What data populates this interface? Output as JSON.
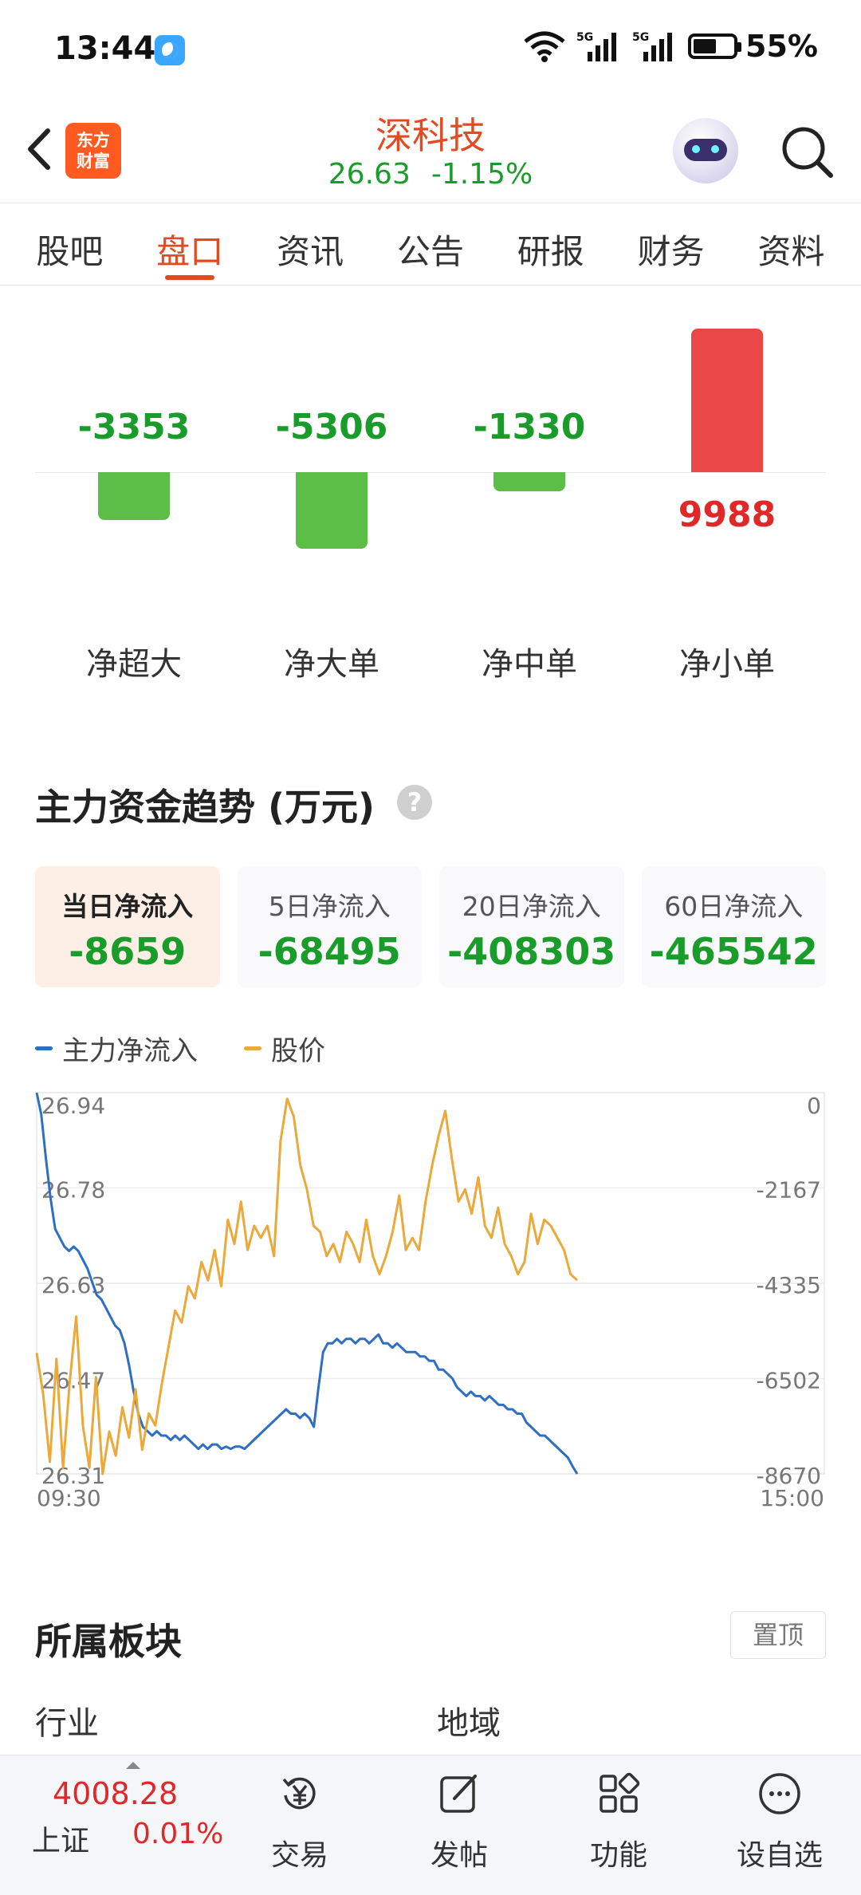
{
  "status_bar": {
    "time": "13:44",
    "network_1": "5G",
    "network_2": "5G",
    "battery_percent": "55%"
  },
  "header": {
    "logo_line1": "东方",
    "logo_line2": "财富",
    "stock_name": "深科技",
    "price": "26.63",
    "change_pct": "-1.15%",
    "icons": [
      "back-arrow-icon",
      "robot-avatar-icon",
      "search-icon"
    ]
  },
  "tabs": [
    {
      "label": "股吧",
      "active": false
    },
    {
      "label": "盘口",
      "active": true
    },
    {
      "label": "资讯",
      "active": false
    },
    {
      "label": "公告",
      "active": false
    },
    {
      "label": "研报",
      "active": false
    },
    {
      "label": "财务",
      "active": false
    },
    {
      "label": "资料",
      "active": false
    }
  ],
  "net_flow": {
    "items": [
      {
        "label": "净超大",
        "value": -3353
      },
      {
        "label": "净大单",
        "value": -5306
      },
      {
        "label": "净中单",
        "value": -1330
      },
      {
        "label": "净小单",
        "value": 9988
      }
    ],
    "colors": {
      "negative": "#5cbd47",
      "positive": "#ea4748",
      "negative_text": "#1a9c2a",
      "positive_text": "#e02828"
    }
  },
  "trend": {
    "title": "主力资金趋势 (万元)",
    "help_icon": "help-circle-icon",
    "cards": [
      {
        "label": "当日净流入",
        "value": "-8659",
        "active": true
      },
      {
        "label": "5日净流入",
        "value": "-68495",
        "active": false
      },
      {
        "label": "20日净流入",
        "value": "-408303",
        "active": false
      },
      {
        "label": "60日净流入",
        "value": "-465542",
        "active": false
      }
    ],
    "legend": [
      {
        "label": "主力净流入",
        "color": "#2f6fc2"
      },
      {
        "label": "股价",
        "color": "#eaa93a"
      }
    ]
  },
  "chart_data": {
    "type": "line",
    "x_labels": [
      "09:30",
      "15:00"
    ],
    "left_axis_ticks": [
      "26.94",
      "26.78",
      "26.63",
      "26.47",
      "26.31"
    ],
    "right_axis_ticks": [
      "0",
      "-2167",
      "-4335",
      "-6502",
      "-8670"
    ],
    "left_ylim": [
      26.31,
      26.94
    ],
    "right_ylim": [
      -8670,
      0
    ],
    "grid": true,
    "series": [
      {
        "name": "主力净流入",
        "axis": "right",
        "color": "#2f6fc2",
        "values": [
          0,
          -500,
          -1500,
          -2400,
          -3100,
          -3300,
          -3500,
          -3600,
          -3500,
          -3600,
          -3800,
          -4000,
          -4300,
          -4600,
          -4700,
          -4900,
          -5100,
          -5300,
          -5400,
          -5700,
          -6200,
          -6800,
          -7300,
          -7600,
          -7700,
          -7800,
          -7700,
          -7800,
          -7800,
          -7900,
          -7800,
          -7900,
          -7800,
          -7900,
          -8000,
          -8100,
          -8000,
          -8100,
          -8000,
          -8000,
          -8100,
          -8050,
          -8100,
          -8050,
          -8050,
          -8100,
          -8000,
          -7900,
          -7800,
          -7700,
          -7600,
          -7500,
          -7400,
          -7300,
          -7200,
          -7300,
          -7300,
          -7400,
          -7300,
          -7400,
          -7600,
          -6700,
          -5900,
          -5700,
          -5700,
          -5600,
          -5700,
          -5600,
          -5600,
          -5700,
          -5600,
          -5600,
          -5700,
          -5600,
          -5500,
          -5700,
          -5700,
          -5800,
          -5700,
          -5800,
          -5900,
          -5900,
          -5900,
          -6000,
          -6000,
          -6100,
          -6100,
          -6300,
          -6300,
          -6400,
          -6500,
          -6700,
          -6800,
          -6900,
          -6800,
          -6900,
          -6900,
          -7000,
          -6900,
          -7000,
          -7100,
          -7100,
          -7200,
          -7200,
          -7300,
          -7300,
          -7500,
          -7600,
          -7700,
          -7800,
          -7800,
          -7900,
          -8000,
          -8100,
          -8200,
          -8300,
          -8500,
          -8670
        ]
      },
      {
        "name": "股价",
        "axis": "left",
        "color": "#eaa93a",
        "values": [
          26.51,
          26.44,
          26.33,
          26.5,
          26.32,
          26.46,
          26.57,
          26.39,
          26.32,
          26.47,
          26.31,
          26.38,
          26.34,
          26.42,
          26.37,
          26.45,
          26.35,
          26.41,
          26.39,
          26.46,
          26.52,
          26.58,
          26.56,
          26.62,
          26.6,
          26.66,
          26.63,
          26.68,
          26.62,
          26.73,
          26.69,
          26.76,
          26.68,
          26.72,
          26.7,
          26.72,
          26.67,
          26.86,
          26.93,
          26.9,
          26.82,
          26.78,
          26.72,
          26.71,
          26.67,
          26.69,
          26.66,
          26.71,
          26.69,
          26.66,
          26.73,
          26.67,
          26.64,
          26.67,
          26.71,
          26.77,
          26.68,
          26.7,
          26.68,
          26.76,
          26.82,
          26.87,
          26.91,
          26.83,
          26.76,
          26.78,
          26.74,
          26.8,
          26.72,
          26.7,
          26.75,
          26.69,
          26.67,
          26.64,
          26.66,
          26.74,
          26.69,
          26.73,
          26.72,
          26.7,
          26.68,
          26.64,
          26.63
        ],
        "extent_fraction": 0.68
      }
    ]
  },
  "sector": {
    "title": "所属板块",
    "pin_label": "置顶",
    "industry_label": "行业",
    "region_label": "地域"
  },
  "bottom_nav": {
    "index_price": "4008.28",
    "index_name": "上证",
    "index_change": "0.01%",
    "items": [
      {
        "label": "交易",
        "icon": "yen-cycle-icon"
      },
      {
        "label": "发帖",
        "icon": "edit-icon"
      },
      {
        "label": "功能",
        "icon": "grid-icon"
      },
      {
        "label": "设自选",
        "icon": "more-circle-icon"
      }
    ]
  }
}
